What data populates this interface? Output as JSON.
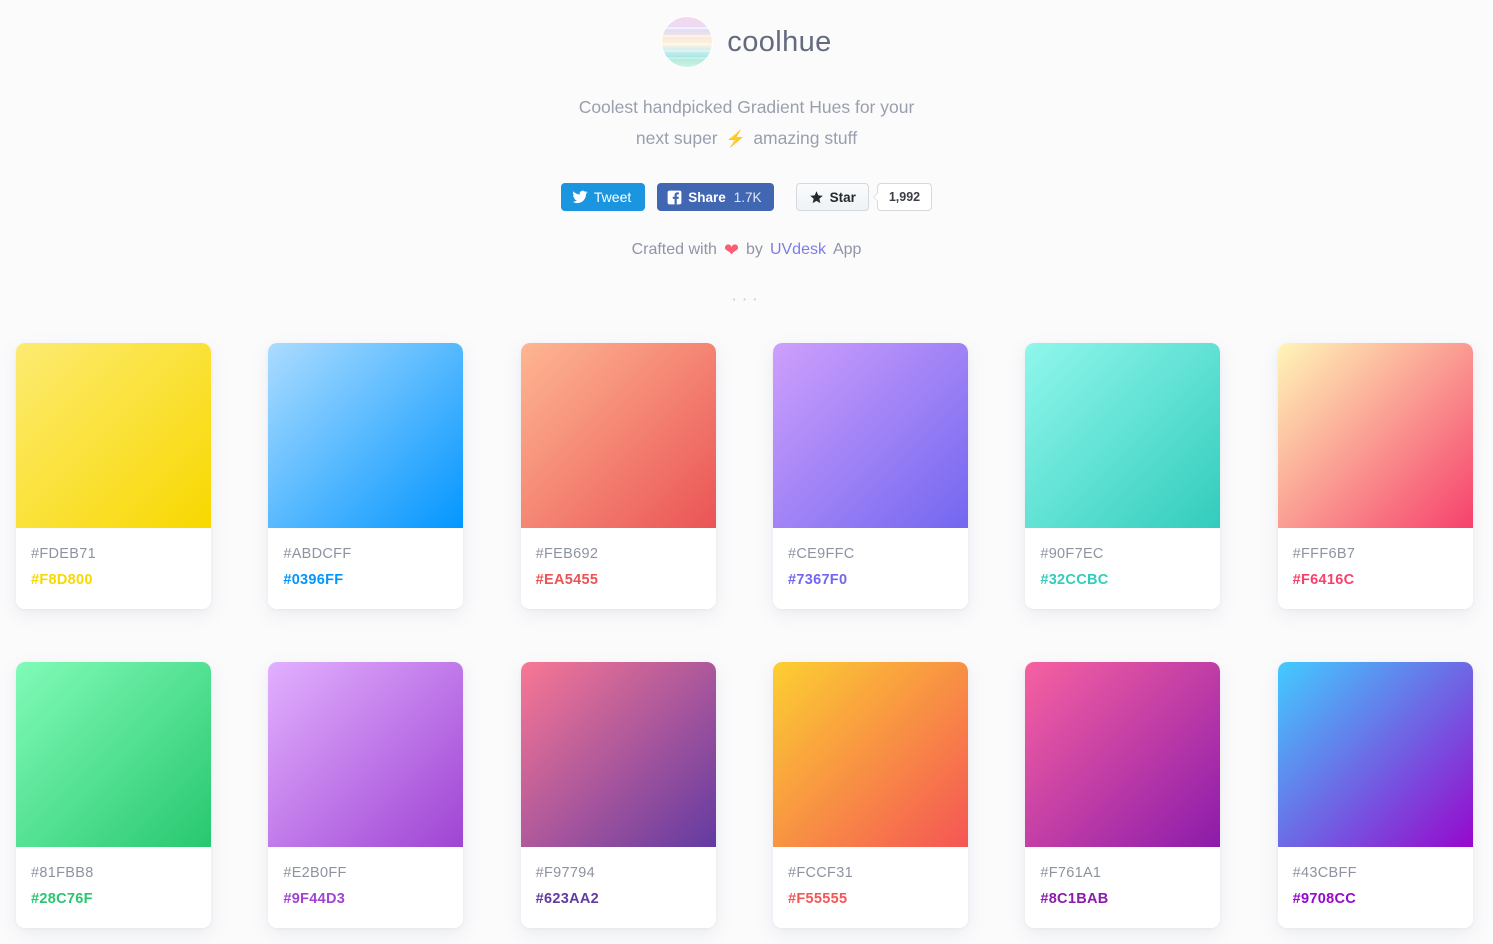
{
  "brand": {
    "name": "coolhue",
    "logo_icon": "gradient-sphere-icon"
  },
  "tagline": {
    "line1": "Coolest handpicked Gradient Hues for your",
    "line2_before": "next super",
    "bolt_icon": "⚡",
    "line2_after": "amazing stuff"
  },
  "social": {
    "tweet_label": "Tweet",
    "tweet_icon": "twitter-icon",
    "tweet_color": "#1b95e0",
    "share_label": "Share",
    "share_count": "1.7K",
    "share_icon": "facebook-icon",
    "share_color": "#4267b2",
    "star_label": "Star",
    "star_icon": "star-icon",
    "star_count": "1,992"
  },
  "credit": {
    "prefix": "Crafted with",
    "heart_icon": "❤",
    "middle": "by",
    "link_text": "UVdesk",
    "link_color": "#7d7ce8",
    "suffix": "App"
  },
  "divider": {
    "dots": "···"
  },
  "gradients": [
    {
      "from": "#FDEB71",
      "to": "#F8D800"
    },
    {
      "from": "#ABDCFF",
      "to": "#0396FF"
    },
    {
      "from": "#FEB692",
      "to": "#EA5455"
    },
    {
      "from": "#CE9FFC",
      "to": "#7367F0"
    },
    {
      "from": "#90F7EC",
      "to": "#32CCBC"
    },
    {
      "from": "#FFF6B7",
      "to": "#F6416C"
    },
    {
      "from": "#81FBB8",
      "to": "#28C76F"
    },
    {
      "from": "#E2B0FF",
      "to": "#9F44D3"
    },
    {
      "from": "#F97794",
      "to": "#623AA2"
    },
    {
      "from": "#FCCF31",
      "to": "#F55555"
    },
    {
      "from": "#F761A1",
      "to": "#8C1BAB"
    },
    {
      "from": "#43CBFF",
      "to": "#9708CC"
    }
  ]
}
